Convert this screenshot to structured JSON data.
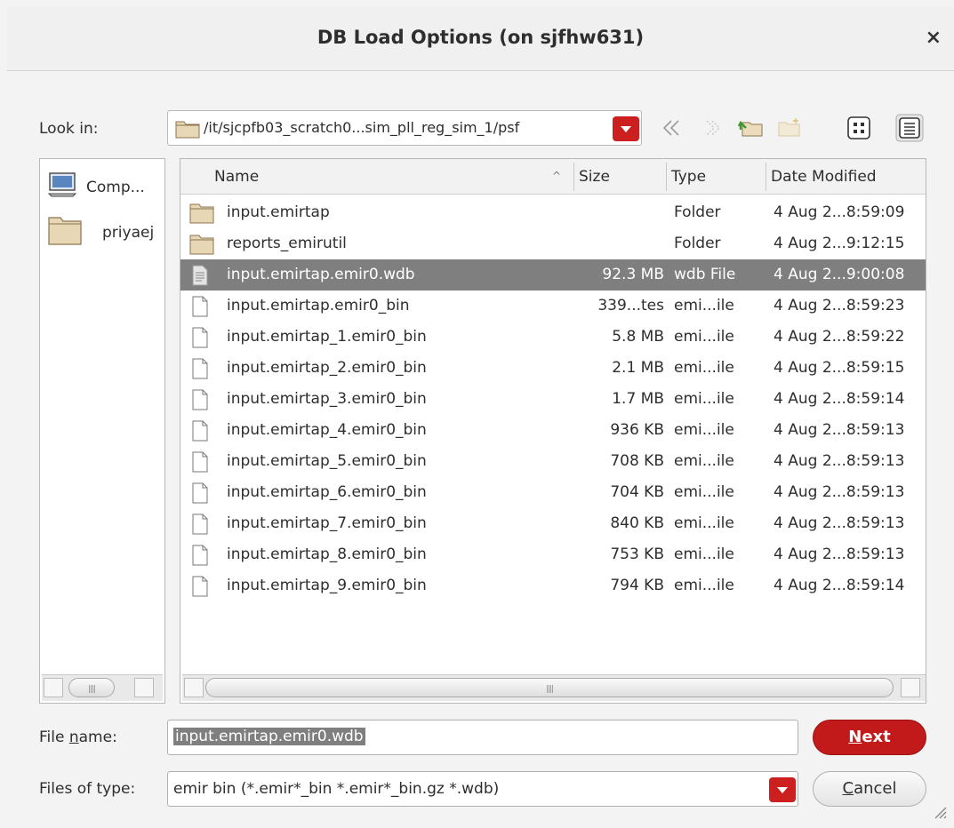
{
  "window": {
    "title": "DB Load Options (on sjfhw631)",
    "close_glyph": "×"
  },
  "lookin": {
    "label": "Look in:",
    "path": "/it/sjcpfb03_scratch0...sim_pll_reg_sim_1/psf"
  },
  "toolbar": {
    "back_icon": "back-arrow-icon",
    "forward_icon": "forward-arrow-icon",
    "up_icon": "parent-folder-icon",
    "new_folder_icon": "new-folder-icon",
    "list_view_icon": "list-view-icon",
    "detail_view_icon": "detail-view-icon"
  },
  "sidebar": {
    "items": [
      {
        "label": "Comp...",
        "icon": "computer-icon"
      },
      {
        "label": "priyaej",
        "icon": "folder-icon"
      }
    ]
  },
  "filelist": {
    "columns": {
      "name": "Name",
      "size": "Size",
      "type": "Type",
      "date": "Date Modified",
      "sort_glyph": "^"
    },
    "rows": [
      {
        "name": "input.emirtap",
        "size": "",
        "type": "Folder",
        "date": "4 Aug 2...8:59:09",
        "icon": "folder-icon"
      },
      {
        "name": "reports_emirutil",
        "size": "",
        "type": "Folder",
        "date": "4 Aug 2...9:12:15",
        "icon": "folder-icon"
      },
      {
        "name": "input.emirtap.emir0.wdb",
        "size": "92.3 MB",
        "type": "wdb File",
        "date": "4 Aug 2...9:00:08",
        "icon": "text-file-icon",
        "selected": true
      },
      {
        "name": "input.emirtap.emir0_bin",
        "size": "339...tes",
        "type": "emi...ile",
        "date": "4 Aug 2...8:59:23",
        "icon": "file-icon"
      },
      {
        "name": "input.emirtap_1.emir0_bin",
        "size": "5.8 MB",
        "type": "emi...ile",
        "date": "4 Aug 2...8:59:22",
        "icon": "file-icon"
      },
      {
        "name": "input.emirtap_2.emir0_bin",
        "size": "2.1 MB",
        "type": "emi...ile",
        "date": "4 Aug 2...8:59:15",
        "icon": "file-icon"
      },
      {
        "name": "input.emirtap_3.emir0_bin",
        "size": "1.7 MB",
        "type": "emi...ile",
        "date": "4 Aug 2...8:59:14",
        "icon": "file-icon"
      },
      {
        "name": "input.emirtap_4.emir0_bin",
        "size": "936 KB",
        "type": "emi...ile",
        "date": "4 Aug 2...8:59:13",
        "icon": "file-icon"
      },
      {
        "name": "input.emirtap_5.emir0_bin",
        "size": "708 KB",
        "type": "emi...ile",
        "date": "4 Aug 2...8:59:13",
        "icon": "file-icon"
      },
      {
        "name": "input.emirtap_6.emir0_bin",
        "size": "704 KB",
        "type": "emi...ile",
        "date": "4 Aug 2...8:59:13",
        "icon": "file-icon"
      },
      {
        "name": "input.emirtap_7.emir0_bin",
        "size": "840 KB",
        "type": "emi...ile",
        "date": "4 Aug 2...8:59:13",
        "icon": "file-icon"
      },
      {
        "name": "input.emirtap_8.emir0_bin",
        "size": "753 KB",
        "type": "emi...ile",
        "date": "4 Aug 2...8:59:13",
        "icon": "file-icon"
      },
      {
        "name": "input.emirtap_9.emir0_bin",
        "size": "794 KB",
        "type": "emi...ile",
        "date": "4 Aug 2...8:59:14",
        "icon": "file-icon"
      }
    ]
  },
  "form": {
    "file_name_label_pre": "File ",
    "file_name_label_ul": "n",
    "file_name_label_post": "ame:",
    "file_name_value": "input.emirtap.emir0.wdb",
    "files_of_type_label": "Files of type:",
    "files_of_type_value": "emir bin (*.emir*_bin *.emir*_bin.gz *.wdb)"
  },
  "buttons": {
    "next_ul": "N",
    "next_rest": "ext",
    "cancel_ul": "C",
    "cancel_rest": "ancel"
  },
  "colors": {
    "accent": "#c21a1a",
    "selection": "#7f7f7f"
  }
}
